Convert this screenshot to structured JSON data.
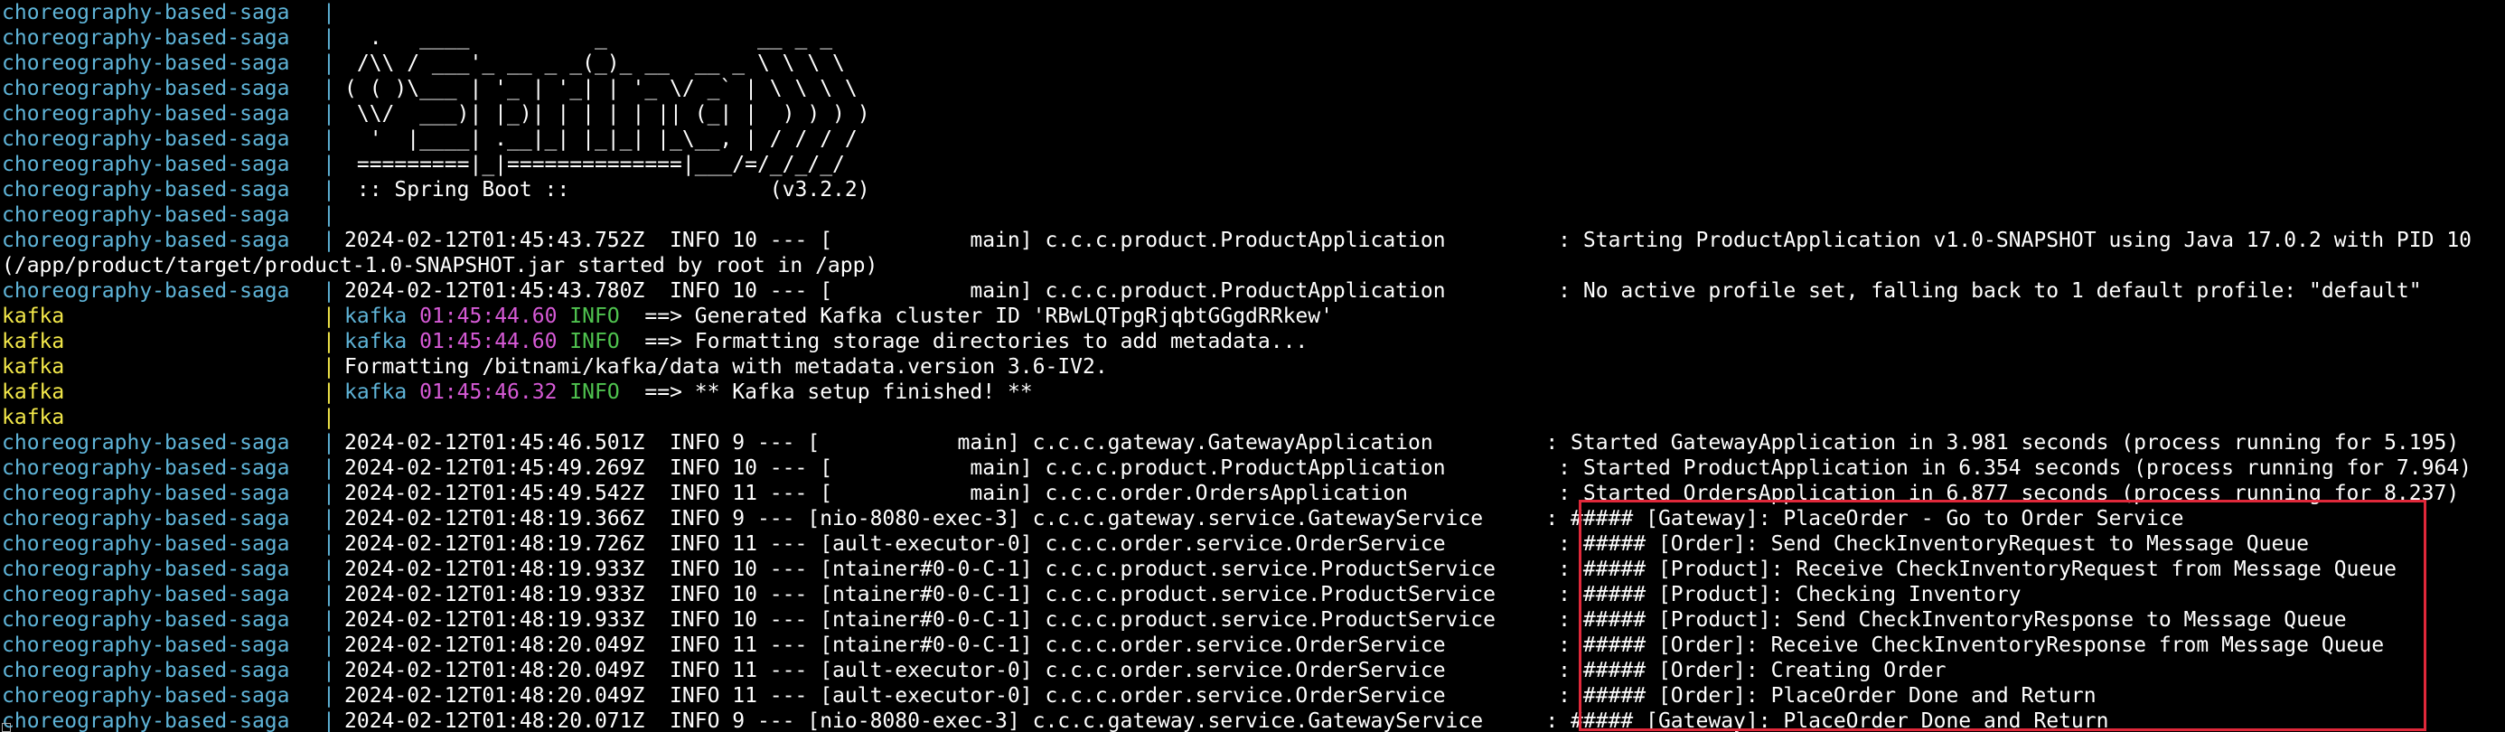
{
  "colors": {
    "background": "#000000",
    "saga_service": "#5fb4d8",
    "kafka_service": "#f4e94a",
    "kafka_tag": "#5fb4d8",
    "timestamp": "#d65ad6",
    "info": "#4fc34f",
    "highlight_border": "#e0283a"
  },
  "separator": "|",
  "lines": [
    {
      "service": "choreography-based-saga",
      "type": "saga",
      "text": ""
    },
    {
      "service": "choreography-based-saga",
      "type": "saga",
      "text": "  .   ____          _            __ _ _"
    },
    {
      "service": "choreography-based-saga",
      "type": "saga",
      "text": " /\\\\ / ___'_ __ _ _(_)_ __  __ _ \\ \\ \\ \\"
    },
    {
      "service": "choreography-based-saga",
      "type": "saga",
      "text": "( ( )\\___ | '_ | '_| | '_ \\/ _` | \\ \\ \\ \\"
    },
    {
      "service": "choreography-based-saga",
      "type": "saga",
      "text": " \\\\/  ___)| |_)| | | | | || (_| |  ) ) ) )"
    },
    {
      "service": "choreography-based-saga",
      "type": "saga",
      "text": "  '  |____| .__|_| |_|_| |_\\__, | / / / /"
    },
    {
      "service": "choreography-based-saga",
      "type": "saga",
      "text": " =========|_|==============|___/=/_/_/_/"
    },
    {
      "service": "choreography-based-saga",
      "type": "saga",
      "text": " :: Spring Boot ::                (v3.2.2)"
    },
    {
      "service": "choreography-based-saga",
      "type": "saga",
      "text": ""
    },
    {
      "service": "choreography-based-saga",
      "type": "saga",
      "text": "2024-02-12T01:45:43.752Z  INFO 10 --- [           main] c.c.c.product.ProductApplication         : Starting ProductApplication v1.0-SNAPSHOT using Java 17.0.2 with PID 10"
    },
    {
      "service": "",
      "type": "wrap",
      "text": "(/app/product/target/product-1.0-SNAPSHOT.jar started by root in /app)"
    },
    {
      "service": "choreography-based-saga",
      "type": "saga",
      "text": "2024-02-12T01:45:43.780Z  INFO 10 --- [           main] c.c.c.product.ProductApplication         : No active profile set, falling back to 1 default profile: \"default\""
    },
    {
      "service": "kafka",
      "type": "kafka",
      "tag": "kafka",
      "time": "01:45:44.60",
      "level": "INFO",
      "text": "  ==> Generated Kafka cluster ID 'RBwLQTpgRjqbtGGgdRRkew'"
    },
    {
      "service": "kafka",
      "type": "kafka",
      "tag": "kafka",
      "time": "01:45:44.60",
      "level": "INFO",
      "text": "  ==> Formatting storage directories to add metadata..."
    },
    {
      "service": "kafka",
      "type": "kafka",
      "text": "Formatting /bitnami/kafka/data with metadata.version 3.6-IV2."
    },
    {
      "service": "kafka",
      "type": "kafka",
      "tag": "kafka",
      "time": "01:45:46.32",
      "level": "INFO",
      "text": "  ==> ** Kafka setup finished! **"
    },
    {
      "service": "kafka",
      "type": "kafka",
      "text": ""
    },
    {
      "service": "choreography-based-saga",
      "type": "saga",
      "text": "2024-02-12T01:45:46.501Z  INFO 9 --- [           main] c.c.c.gateway.GatewayApplication         : Started GatewayApplication in 3.981 seconds (process running for 5.195)"
    },
    {
      "service": "choreography-based-saga",
      "type": "saga",
      "text": "2024-02-12T01:45:49.269Z  INFO 10 --- [           main] c.c.c.product.ProductApplication         : Started ProductApplication in 6.354 seconds (process running for 7.964)"
    },
    {
      "service": "choreography-based-saga",
      "type": "saga",
      "text": "2024-02-12T01:45:49.542Z  INFO 11 --- [           main] c.c.c.order.OrdersApplication            : Started OrdersApplication in 6.877 seconds (process running for 8.237)"
    },
    {
      "service": "choreography-based-saga",
      "type": "saga",
      "text": "2024-02-12T01:48:19.366Z  INFO 9 --- [nio-8080-exec-3] c.c.c.gateway.service.GatewayService     : ##### [Gateway]: PlaceOrder - Go to Order Service"
    },
    {
      "service": "choreography-based-saga",
      "type": "saga",
      "text": "2024-02-12T01:48:19.726Z  INFO 11 --- [ault-executor-0] c.c.c.order.service.OrderService         : ##### [Order]: Send CheckInventoryRequest to Message Queue"
    },
    {
      "service": "choreography-based-saga",
      "type": "saga",
      "text": "2024-02-12T01:48:19.933Z  INFO 10 --- [ntainer#0-0-C-1] c.c.c.product.service.ProductService     : ##### [Product]: Receive CheckInventoryRequest from Message Queue"
    },
    {
      "service": "choreography-based-saga",
      "type": "saga",
      "text": "2024-02-12T01:48:19.933Z  INFO 10 --- [ntainer#0-0-C-1] c.c.c.product.service.ProductService     : ##### [Product]: Checking Inventory"
    },
    {
      "service": "choreography-based-saga",
      "type": "saga",
      "text": "2024-02-12T01:48:19.933Z  INFO 10 --- [ntainer#0-0-C-1] c.c.c.product.service.ProductService     : ##### [Product]: Send CheckInventoryResponse to Message Queue"
    },
    {
      "service": "choreography-based-saga",
      "type": "saga",
      "text": "2024-02-12T01:48:20.049Z  INFO 11 --- [ntainer#0-0-C-1] c.c.c.order.service.OrderService         : ##### [Order]: Receive CheckInventoryResponse from Message Queue"
    },
    {
      "service": "choreography-based-saga",
      "type": "saga",
      "text": "2024-02-12T01:48:20.049Z  INFO 11 --- [ault-executor-0] c.c.c.order.service.OrderService         : ##### [Order]: Creating Order"
    },
    {
      "service": "choreography-based-saga",
      "type": "saga",
      "text": "2024-02-12T01:48:20.049Z  INFO 11 --- [ault-executor-0] c.c.c.order.service.OrderService         : ##### [Order]: PlaceOrder Done and Return"
    },
    {
      "service": "choreography-based-saga",
      "type": "saga",
      "text": "2024-02-12T01:48:20.071Z  INFO 9 --- [nio-8080-exec-3] c.c.c.gateway.service.GatewayService     : ##### [Gateway]: PlaceOrder Done and Return"
    }
  ]
}
